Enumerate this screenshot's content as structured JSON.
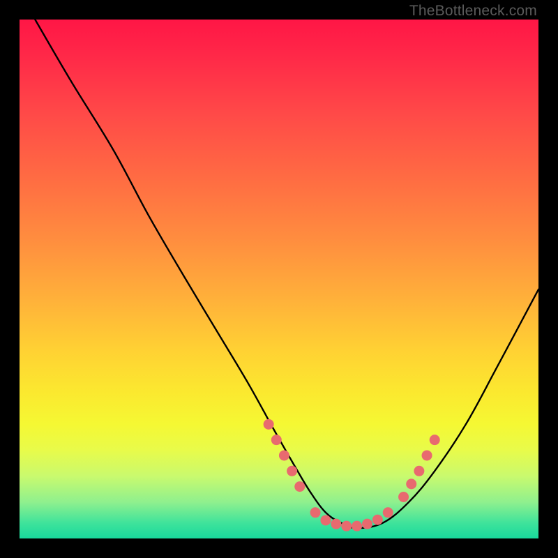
{
  "watermark": "TheBottleneck.com",
  "colors": {
    "frame": "#000000",
    "curve": "#000000",
    "markers": "#e86a6f",
    "gradient_top": "#ff1646",
    "gradient_bottom": "#18d99c"
  },
  "chart_data": {
    "type": "line",
    "title": "",
    "xlabel": "",
    "ylabel": "",
    "xlim": [
      0,
      100
    ],
    "ylim": [
      0,
      100
    ],
    "series": [
      {
        "name": "bottleneck-curve",
        "x": [
          3,
          10,
          18,
          25,
          32,
          38,
          44,
          49,
          53,
          56,
          59,
          62,
          65,
          70,
          75,
          80,
          86,
          92,
          100
        ],
        "y": [
          100,
          88,
          75,
          62,
          50,
          40,
          30,
          21,
          14,
          9,
          5,
          3,
          2,
          3,
          7,
          13,
          22,
          33,
          48
        ]
      }
    ],
    "markers": {
      "name": "highlight-dots",
      "left_cluster": [
        [
          48,
          22
        ],
        [
          49.5,
          19
        ],
        [
          51,
          16
        ],
        [
          52.5,
          13
        ],
        [
          54,
          10
        ]
      ],
      "bottom_cluster": [
        [
          57,
          5
        ],
        [
          59,
          3.5
        ],
        [
          61,
          2.8
        ],
        [
          63,
          2.4
        ],
        [
          65,
          2.4
        ],
        [
          67,
          2.8
        ],
        [
          69,
          3.6
        ],
        [
          71,
          5
        ]
      ],
      "right_cluster": [
        [
          74,
          8
        ],
        [
          75.5,
          10.5
        ],
        [
          77,
          13
        ],
        [
          78.5,
          16
        ],
        [
          80,
          19
        ]
      ]
    }
  }
}
